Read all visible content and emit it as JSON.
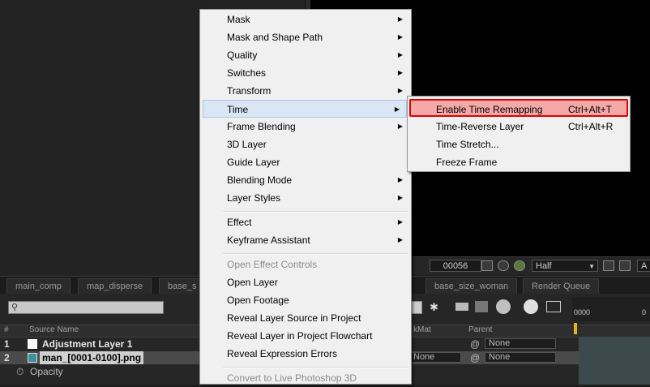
{
  "context_menu": {
    "items": [
      {
        "label": "Mask",
        "submenu": true
      },
      {
        "label": "Mask and Shape Path",
        "submenu": true
      },
      {
        "label": "Quality",
        "submenu": true
      },
      {
        "label": "Switches",
        "submenu": true
      },
      {
        "label": "Transform",
        "submenu": true
      },
      {
        "label": "Time",
        "submenu": true,
        "highlighted": true
      },
      {
        "label": "Frame Blending",
        "submenu": true
      },
      {
        "label": "3D Layer",
        "submenu": false
      },
      {
        "label": "Guide Layer",
        "submenu": false
      },
      {
        "label": "Blending Mode",
        "submenu": true
      },
      {
        "label": "Layer Styles",
        "submenu": true
      },
      {
        "label": "Effect",
        "submenu": true
      },
      {
        "label": "Keyframe Assistant",
        "submenu": true
      },
      {
        "label": "Open Effect Controls",
        "disabled": true
      },
      {
        "label": "Open Layer"
      },
      {
        "label": "Open Footage"
      },
      {
        "label": "Reveal Layer Source in Project"
      },
      {
        "label": "Reveal Layer in Project Flowchart"
      },
      {
        "label": "Reveal Expression Errors"
      },
      {
        "label": "Convert to Live Photoshop 3D",
        "disabled": true
      }
    ],
    "arrow_glyph": "▶"
  },
  "time_submenu": {
    "items": [
      {
        "label": "Enable Time Remapping",
        "shortcut": "Ctrl+Alt+T",
        "highlighted": true
      },
      {
        "label": "Time-Reverse Layer",
        "shortcut": "Ctrl+Alt+R"
      },
      {
        "label": "Time Stretch...",
        "shortcut": ""
      },
      {
        "label": "Freeze Frame",
        "shortcut": ""
      }
    ]
  },
  "viewer_toolbar": {
    "frame": "00056",
    "resolution": "Half",
    "overflow": "A"
  },
  "tabs": [
    "main_comp",
    "map_disperse",
    "base_s",
    "base_size_woman",
    "Render Queue"
  ],
  "timeline": {
    "columns": {
      "number": "#",
      "source_name": "Source Name",
      "trkmat": "kMat",
      "parent": "Parent"
    },
    "layers": [
      {
        "number": "1",
        "name": "Adjustment Layer 1",
        "parent": "None"
      },
      {
        "number": "2",
        "name": "man_[0001-0100].png",
        "trkmat": "None",
        "parent": "None"
      }
    ],
    "property": "Opacity",
    "ruler_start": "0000"
  },
  "colors": {
    "highlight_red": "#e00000",
    "menu_bg": "#f0f0f0",
    "menu_hover": "#dae6f4"
  }
}
